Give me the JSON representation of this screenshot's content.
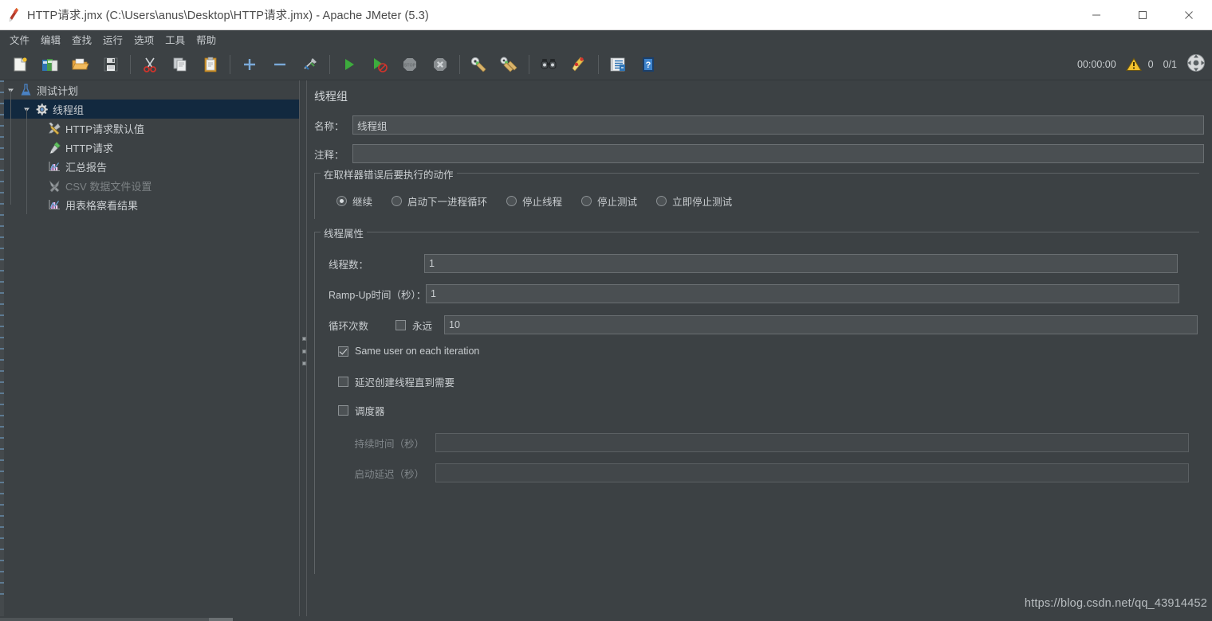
{
  "window": {
    "title": "HTTP请求.jmx (C:\\Users\\anus\\Desktop\\HTTP请求.jmx) - Apache JMeter (5.3)",
    "app_icon": "jmeter-feather-icon",
    "minimize": "–",
    "maximize": "□",
    "close": "✕"
  },
  "menubar": {
    "items": [
      {
        "label": "文件"
      },
      {
        "label": "编辑"
      },
      {
        "label": "查找"
      },
      {
        "label": "运行"
      },
      {
        "label": "选项"
      },
      {
        "label": "工具"
      },
      {
        "label": "帮助"
      }
    ]
  },
  "toolbar": {
    "buttons": [
      {
        "name": "new-icon"
      },
      {
        "name": "templates-icon"
      },
      {
        "name": "open-icon"
      },
      {
        "name": "save-icon"
      },
      {
        "name": "cut-icon"
      },
      {
        "name": "copy-icon"
      },
      {
        "name": "paste-icon"
      },
      {
        "name": "expand-all-icon"
      },
      {
        "name": "collapse-all-icon"
      },
      {
        "name": "toggle-icon"
      },
      {
        "name": "start-icon"
      },
      {
        "name": "start-no-pauses-icon"
      },
      {
        "name": "stop-icon"
      },
      {
        "name": "shutdown-icon"
      },
      {
        "name": "clear-icon"
      },
      {
        "name": "clear-all-icon"
      },
      {
        "name": "search-icon"
      },
      {
        "name": "reset-search-icon"
      },
      {
        "name": "function-helper-icon"
      },
      {
        "name": "help-icon"
      }
    ],
    "elapsed_time": "00:00:00",
    "warning_count": "0",
    "thread_count": "0/1",
    "remote_icon": "remote-start-icon"
  },
  "tree": {
    "nodes": [
      {
        "label": "测试计划",
        "icon": "test-plan-icon",
        "expanded": true,
        "depth": 0,
        "selected": false,
        "disabled": false
      },
      {
        "label": "线程组",
        "icon": "thread-group-icon",
        "expanded": true,
        "depth": 1,
        "selected": true,
        "disabled": false
      },
      {
        "label": "HTTP请求默认值",
        "icon": "http-defaults-icon",
        "depth": 2,
        "selected": false,
        "disabled": false
      },
      {
        "label": "HTTP请求",
        "icon": "http-sampler-icon",
        "depth": 2,
        "selected": false,
        "disabled": false
      },
      {
        "label": "汇总报告",
        "icon": "summary-report-icon",
        "depth": 2,
        "selected": false,
        "disabled": false
      },
      {
        "label": "CSV 数据文件设置",
        "icon": "csv-data-set-icon",
        "depth": 2,
        "selected": false,
        "disabled": true
      },
      {
        "label": "用表格察看结果",
        "icon": "view-results-table-icon",
        "depth": 2,
        "selected": false,
        "disabled": false
      }
    ]
  },
  "panel": {
    "title": "线程组",
    "name_label": "名称：",
    "name_value": "线程组",
    "comment_label": "注释：",
    "comment_value": "",
    "comment_placeholder": "",
    "error_action": {
      "legend": "在取样器错误后要执行的动作",
      "options": [
        {
          "label": "继续",
          "selected": true
        },
        {
          "label": "启动下一进程循环",
          "selected": false
        },
        {
          "label": "停止线程",
          "selected": false
        },
        {
          "label": "停止测试",
          "selected": false
        },
        {
          "label": "立即停止测试",
          "selected": false
        }
      ]
    },
    "thread_properties": {
      "legend": "线程属性",
      "threads_label": "线程数：",
      "threads_value": "1",
      "rampup_label": "Ramp-Up时间（秒）：",
      "rampup_value": "1",
      "loops_label": "循环次数",
      "forever_label": "永远",
      "forever_checked": false,
      "loops_value": "10",
      "same_user_label": "Same user on each iteration",
      "same_user_checked": true,
      "delay_thread_label": "延迟创建线程直到需要",
      "delay_thread_checked": false,
      "scheduler_label": "调度器",
      "scheduler_checked": false,
      "duration_label": "持续时间（秒）",
      "duration_value": "",
      "duration_enabled": false,
      "startup_delay_label": "启动延迟（秒）",
      "startup_delay_value": "",
      "startup_delay_enabled": false
    }
  },
  "watermark": "https://blog.csdn.net/qq_43914452",
  "colors": {
    "background": "#3c4144",
    "titlebar": "#ffffff",
    "selection": "#12293f",
    "text": "#c9cdd0",
    "text_disabled": "#80868a",
    "field": "#4a4f52",
    "field_border": "#6a6f72",
    "warning": "#f2c12e",
    "run_green": "#3dab3d"
  }
}
